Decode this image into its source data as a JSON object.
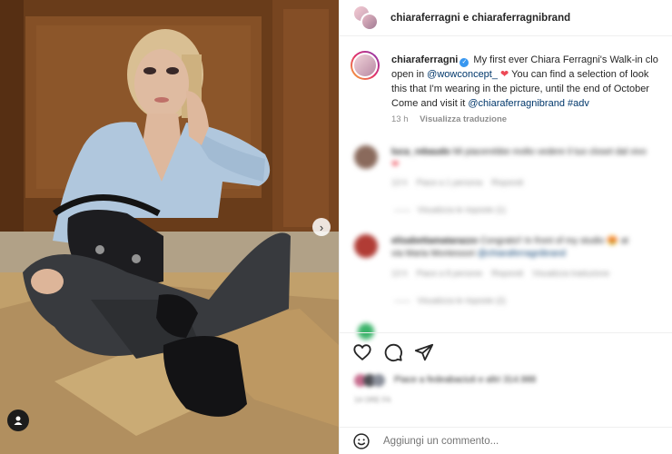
{
  "header": {
    "title": "chiaraferragni e chiaraferragnibrand"
  },
  "caption": {
    "username": "chiaraferragni",
    "line1_text": " My first ever Chiara Ferragni's Walk-in clo",
    "line2_prefix": "open in ",
    "line2_mention": "@wowconcept_",
    "line2_heart": " ❤",
    "line2_suffix": " You can find a selection of look",
    "line3": "this that I'm wearing in the picture, until the end of October",
    "line4_prefix": "Come and visit it ",
    "line4_mention": "@chiaraferragnibrand",
    "line4_hashtag": " #adv",
    "time": "13 h",
    "translate": "Visualizza traduzione"
  },
  "comments": [
    {
      "user": "luca_rebaudo",
      "text": "Mi piacerebbe molto vedere il tuo closet dal vivo",
      "emoji": "❤",
      "meta_a": "13 h",
      "meta_b": "Piace a 1 persona",
      "meta_c": "Rispondi",
      "replies": "Visualizza le risposte (1)",
      "avatar_color": "#8a6a5c"
    },
    {
      "user": "elisabettamatarazzo",
      "text": "Congrats!! In front of my studio 😍 at ",
      "text2": "via Maria Montessori ",
      "mention": "@chiaraferragnibrand",
      "meta_a": "13 h",
      "meta_b": "Piace a 8 persone",
      "meta_c": "Rispondi",
      "meta_d": "Visualizza traduzione",
      "replies": "Visualizza le risposte (2)",
      "avatar_color": "#b13c35"
    }
  ],
  "likes": {
    "text": "Piace a fedeabaciuti e altri 314.988"
  },
  "date": "14 ORE FA",
  "comment_input": {
    "placeholder": "Aggiungi un commento..."
  },
  "icons": {
    "like": "heart-icon",
    "comment": "comment-icon",
    "share": "share-icon",
    "emoji": "emoji-icon",
    "next": "chevron-right-icon",
    "tag": "user-tag-icon"
  }
}
